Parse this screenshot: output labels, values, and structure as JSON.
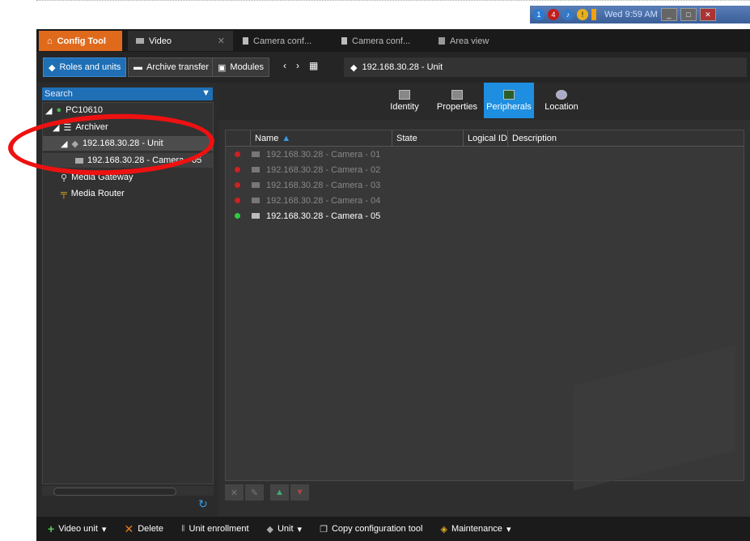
{
  "tray": {
    "time": "Wed 9:59 AM",
    "badge_blue": "1",
    "badge_red": "4"
  },
  "tabs": [
    {
      "label": "Config Tool"
    },
    {
      "label": "Video"
    },
    {
      "label": "Camera conf..."
    },
    {
      "label": "Camera conf..."
    },
    {
      "label": "Area view"
    }
  ],
  "toolbar": {
    "roles": "Roles and units",
    "archive": "Archive transfer",
    "modules": "Modules",
    "breadcrumb": "192.168.30.28 - Unit"
  },
  "left": {
    "search_placeholder": "Search",
    "tree": [
      {
        "label": "PC10610",
        "indent": 0
      },
      {
        "label": "Archiver",
        "indent": 1
      },
      {
        "label": "192.168.30.28 - Unit",
        "indent": 2
      },
      {
        "label": "192.168.30.28 - Camera - 05",
        "indent": 3
      },
      {
        "label": "Media Gateway",
        "indent": 1
      },
      {
        "label": "Media Router",
        "indent": 1
      }
    ]
  },
  "content_tabs": [
    "Identity",
    "Properties",
    "Peripherals",
    "Location"
  ],
  "grid": {
    "columns": [
      "Name",
      "State",
      "Logical ID",
      "Description"
    ],
    "rows": [
      {
        "name": "192.168.30.28 - Camera - 01",
        "status": "offline"
      },
      {
        "name": "192.168.30.28 - Camera - 02",
        "status": "offline"
      },
      {
        "name": "192.168.30.28 - Camera - 03",
        "status": "offline"
      },
      {
        "name": "192.168.30.28 - Camera - 04",
        "status": "offline"
      },
      {
        "name": "192.168.30.28 - Camera - 05",
        "status": "online"
      }
    ]
  },
  "bottom": {
    "video_unit": "Video unit",
    "delete": "Delete",
    "unit_enrollment": "Unit enrollment",
    "unit": "Unit",
    "copy_config": "Copy configuration tool",
    "maintenance": "Maintenance"
  },
  "colors": {
    "accent": "#1e8fe0",
    "config_tab": "#e06a1b",
    "online": "#2ecc40",
    "offline": "#cc2222",
    "annotation": "#ee1111"
  }
}
